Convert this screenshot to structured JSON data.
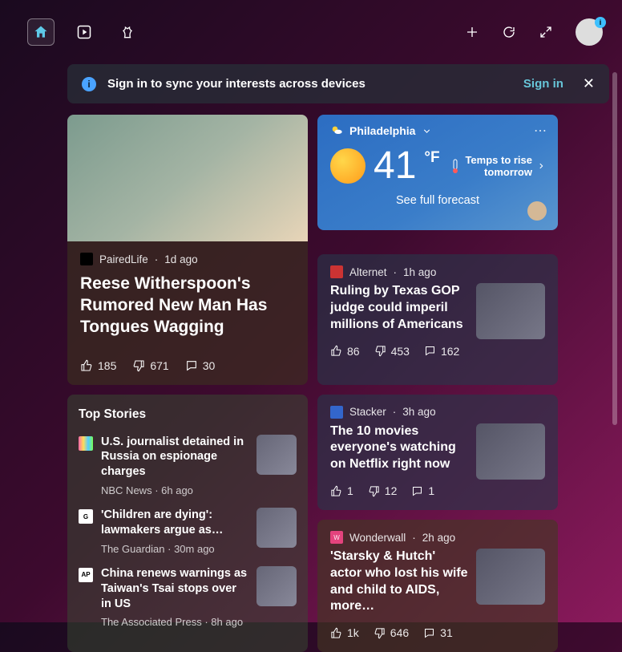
{
  "banner": {
    "text": "Sign in to sync your interests across devices",
    "signin": "Sign in"
  },
  "hero": {
    "source": "PairedLife",
    "time": "1d ago",
    "headline": "Reese Witherspoon's Rumored New Man Has Tongues Wagging",
    "likes": "185",
    "dislikes": "671",
    "comments": "30"
  },
  "weather": {
    "location": "Philadelphia",
    "temp": "41",
    "unit": "°F",
    "note_l1": "Temps to rise",
    "note_l2": "tomorrow",
    "forecast": "See full forecast"
  },
  "stories": [
    {
      "source": "Alternet",
      "time": "1h ago",
      "headline": "Ruling by Texas GOP judge could imperil millions of Americans",
      "likes": "86",
      "dislikes": "453",
      "comments": "162"
    },
    {
      "source": "Stacker",
      "time": "3h ago",
      "headline": "The 10 movies everyone's watching on Netflix right now",
      "likes": "1",
      "dislikes": "12",
      "comments": "1"
    },
    {
      "source": "Wonderwall",
      "time": "2h ago",
      "headline": "'Starsky & Hutch' actor who lost his wife and child to AIDS, more…",
      "likes": "1k",
      "dislikes": "646",
      "comments": "31"
    }
  ],
  "topstories": {
    "title": "Top Stories",
    "items": [
      {
        "headline": "U.S. journalist detained in Russia on espionage charges",
        "source": "NBC News",
        "time": "6h ago"
      },
      {
        "headline": "'Children are dying': lawmakers argue as…",
        "source": "The Guardian",
        "time": "30m ago"
      },
      {
        "headline": "China renews warnings as Taiwan's Tsai stops over in US",
        "source": "The Associated Press",
        "time": "8h ago"
      }
    ]
  },
  "sep": " · "
}
